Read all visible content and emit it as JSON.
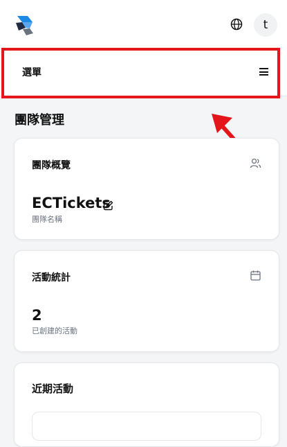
{
  "header": {
    "logo_icon": "ecticket-logo-icon",
    "language_icon": "globe-icon",
    "avatar_initial": "t"
  },
  "menu": {
    "label": "選單",
    "toggle_icon": "hamburger-menu-icon"
  },
  "annotation": {
    "highlight_color": "#e4151b"
  },
  "page": {
    "title": "團隊管理"
  },
  "team_overview": {
    "title": "團隊概覽",
    "icon": "users-icon",
    "team_name": "ECTickets",
    "edit_icon": "edit-icon",
    "team_name_label": "團隊名稱"
  },
  "activity_stats": {
    "title": "活動統計",
    "icon": "calendar-icon",
    "count": "2",
    "count_label": "已創建的活動"
  },
  "recent_events": {
    "title": "近期活動"
  }
}
